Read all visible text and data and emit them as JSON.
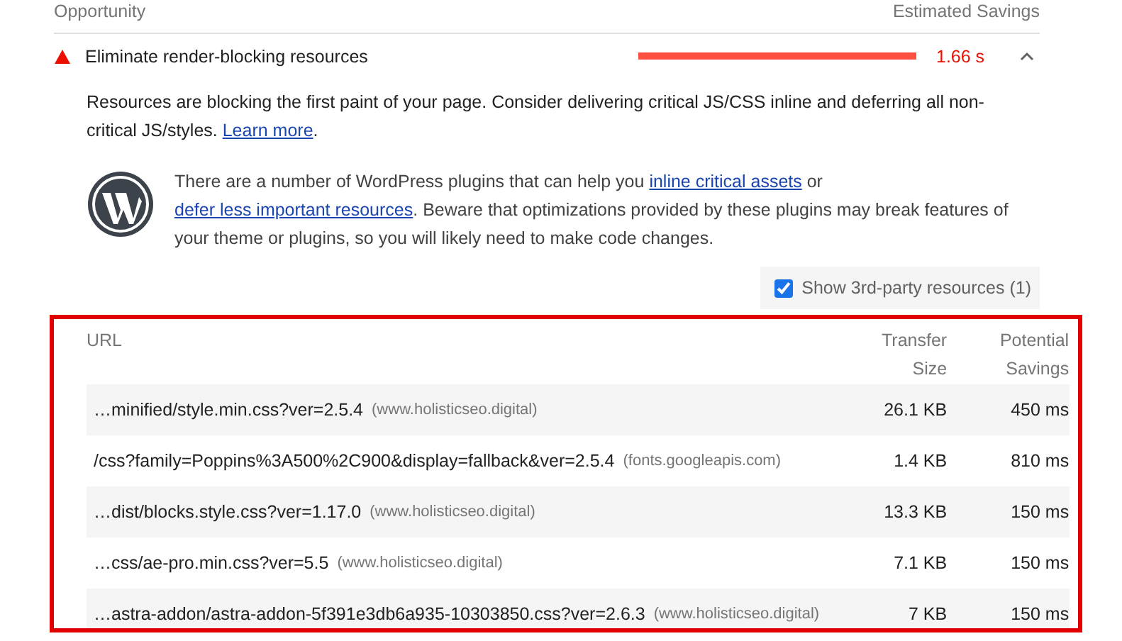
{
  "header": {
    "label": "Opportunity",
    "savings_label": "Estimated Savings"
  },
  "audit": {
    "title": "Eliminate render-blocking resources",
    "savings": "1.66 s",
    "expanded": true
  },
  "description": [
    {
      "text": "Resources are blocking the first paint of your page. Consider delivering critical JS/CSS inline and deferring all non-critical JS/styles. ",
      "link": false
    },
    {
      "text": "Learn more",
      "link": true
    },
    {
      "text": ".",
      "link": false
    }
  ],
  "wordpress_note": [
    {
      "text": "There are a number of WordPress plugins that can help you ",
      "link": false
    },
    {
      "text": "inline critical assets",
      "link": true
    },
    {
      "text": " or ",
      "link": false
    },
    {
      "text": "defer less important resources",
      "link": true
    },
    {
      "text": ". Beware that optimizations provided by these plugins may break features of your theme or plugins, so you will likely need to make code changes.",
      "link": false
    }
  ],
  "third_party": {
    "label": "Show 3rd-party resources (1)",
    "checked": true
  },
  "table": {
    "highlighted": true,
    "columns": [
      "URL",
      "Transfer Size",
      "Potential Savings"
    ],
    "rows": [
      {
        "url": "…minified/style.min.css?ver=2.5.4",
        "host": "(www.holisticseo.digital)",
        "size": "26.1 KB",
        "savings": "450 ms"
      },
      {
        "url": "/css?family=Poppins%3A500%2C900&display=fallback&ver=2.5.4",
        "host": "(fonts.googleapis.com)",
        "size": "1.4 KB",
        "savings": "810 ms"
      },
      {
        "url": "…dist/blocks.style.css?ver=1.17.0",
        "host": "(www.holisticseo.digital)",
        "size": "13.3 KB",
        "savings": "150 ms"
      },
      {
        "url": "…css/ae-pro.min.css?ver=5.5",
        "host": "(www.holisticseo.digital)",
        "size": "7.1 KB",
        "savings": "150 ms"
      },
      {
        "url": "…astra-addon/astra-addon-5f391e3db6a935-10303850.css?ver=2.6.3",
        "host": "(www.holisticseo.digital)",
        "size": "7 KB",
        "savings": "150 ms"
      }
    ]
  }
}
